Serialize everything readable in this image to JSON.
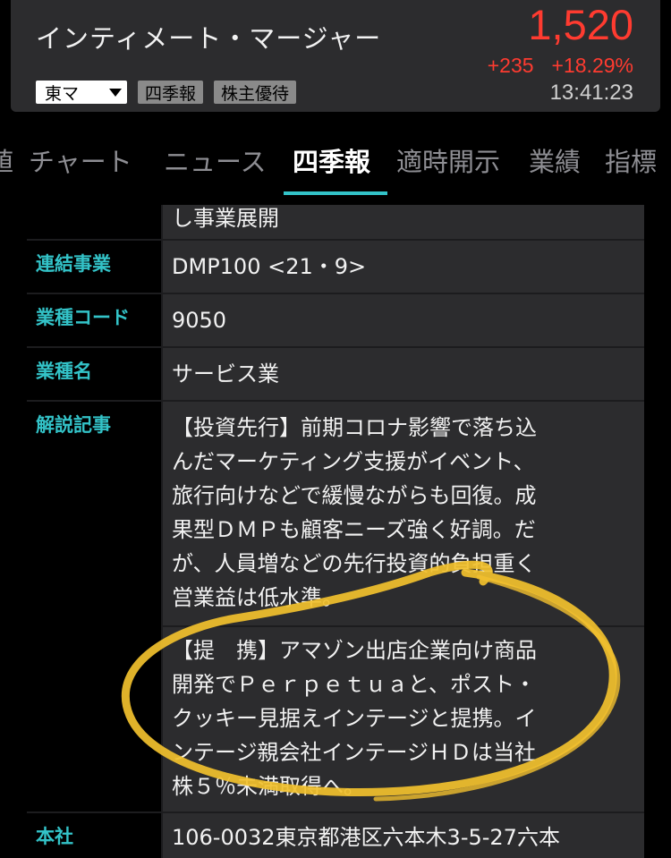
{
  "header": {
    "company_name": "インティメート・マージャー",
    "price": "1,520",
    "change_abs": "+235",
    "change_pct": "+18.29%",
    "time": "13:41:23",
    "market": "東マ",
    "badge_1": "四季報",
    "badge_2": "株主優待"
  },
  "tabs": [
    {
      "label": "値"
    },
    {
      "label": "チャート"
    },
    {
      "label": "ニュース"
    },
    {
      "label": "四季報"
    },
    {
      "label": "適時開示"
    },
    {
      "label": "業績"
    },
    {
      "label": "指標"
    }
  ],
  "rows": {
    "top_partial": "し事業展開",
    "r1_key": "連結事業",
    "r1_val": "DMP100 <21・9>",
    "r2_key": "業種コード",
    "r2_val": "9050",
    "r3_key": "業種名",
    "r3_val": "サービス業",
    "r4_key": "解説記事",
    "r4_para1": [
      "【投資先行】前期コロナ影響で落ち込",
      "んだマーケティング支援がイベント、",
      "旅行向けなどで緩慢ながらも回復。成",
      "果型ＤＭＰも顧客ニーズ強く好調。だ",
      "が、人員増などの先行投資的負担重く",
      "営業益は低水準。"
    ],
    "r4_para2": [
      "【提　携】アマゾン出店企業向け商品",
      "開発でＰｅｒｐｅｔｕａと、ポスト・",
      "クッキー見据えインテージと提携。イ",
      "ンテージ親会社インテージＨＤは当社",
      "株５％未満取得へ。"
    ],
    "r5_key": "本社",
    "r5_val": "106-0032東京都港区六本木3-5-27六本"
  },
  "colors": {
    "accent": "#33c3c8",
    "price_up": "#ff3b30",
    "scribble": "#f2c12e"
  }
}
